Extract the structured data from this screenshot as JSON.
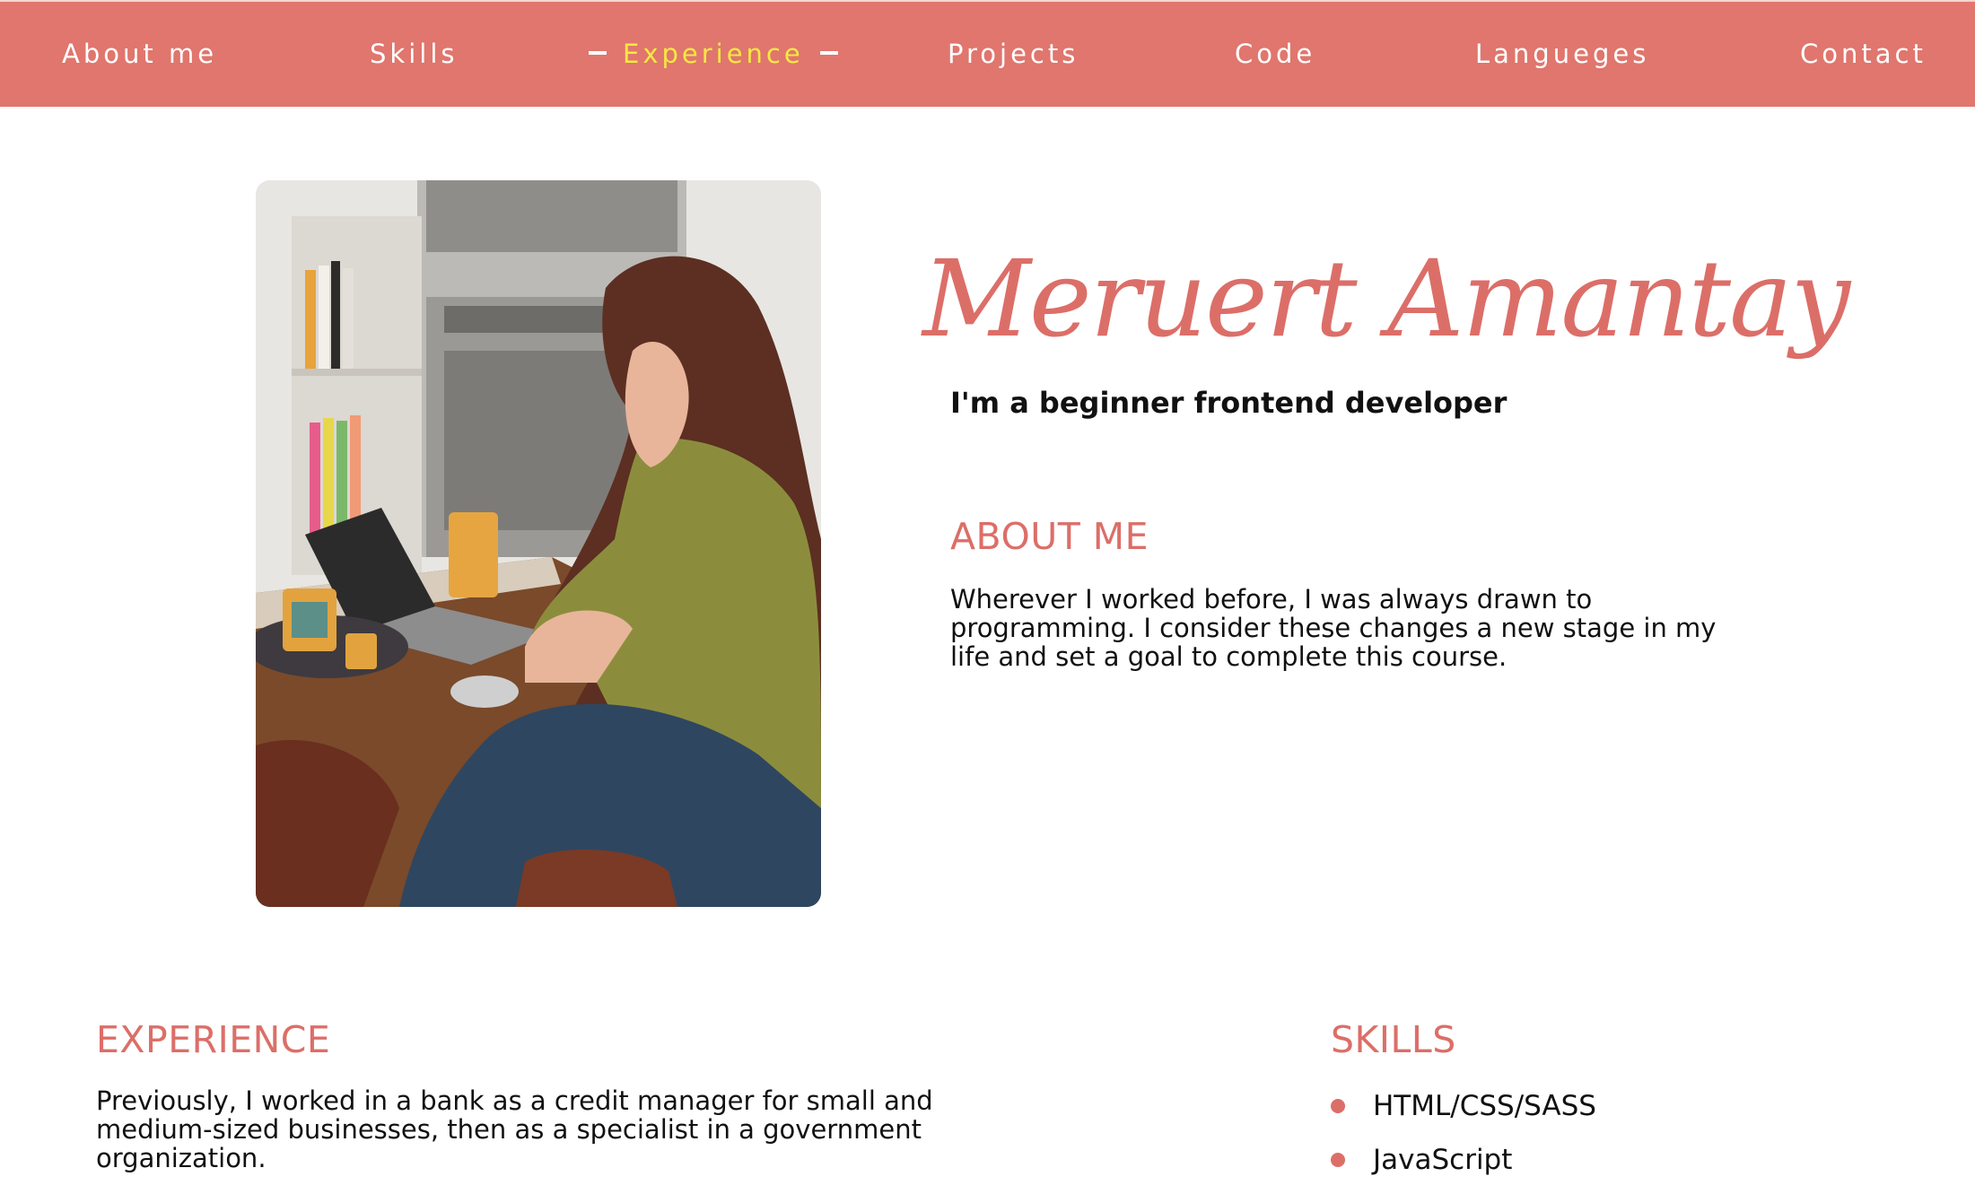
{
  "nav": {
    "items": [
      {
        "label": "About me"
      },
      {
        "label": "Skills"
      },
      {
        "label": "Experience"
      },
      {
        "label": "Projects"
      },
      {
        "label": "Code"
      },
      {
        "label": "Langueges"
      },
      {
        "label": "Contact"
      }
    ],
    "active": "Experience"
  },
  "hero": {
    "name": "Meruert Amantay",
    "tagline": "I'm a beginner frontend developer"
  },
  "about": {
    "heading": "ABOUT ME",
    "text": "Wherever I worked before, I was always drawn to programming. I consider these changes a new stage in my life and set a goal to complete this course."
  },
  "experience": {
    "heading": "EXPERIENCE",
    "text": "Previously, I worked in a bank as a credit manager for small and medium-sized businesses, then as a specialist in a government organization."
  },
  "skills": {
    "heading": "SKILLS",
    "items": [
      "HTML/CSS/SASS",
      "JavaScript"
    ]
  },
  "colors": {
    "nav_background": "#e0766d",
    "accent": "#dc6e68",
    "active_nav": "#f4e842",
    "text": "#111111"
  }
}
